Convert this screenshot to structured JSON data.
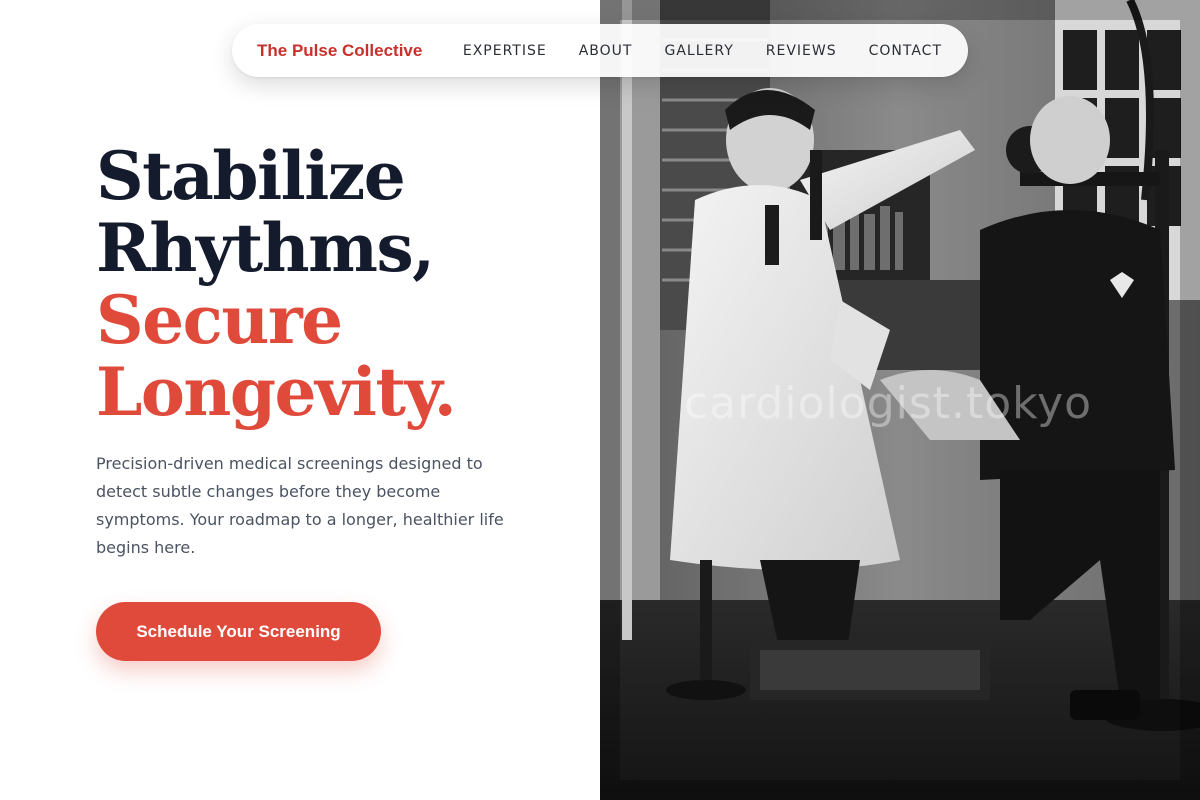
{
  "nav": {
    "brand": "The Pulse Collective",
    "links": [
      "EXPERTISE",
      "ABOUT",
      "GALLERY",
      "REVIEWS",
      "CONTACT"
    ]
  },
  "hero": {
    "headline_dark": [
      "Stabilize",
      "Rhythms,"
    ],
    "headline_accent": [
      "Secure",
      "Longevity."
    ],
    "lede": "Precision-driven medical screenings designed to detect subtle changes before they become symptoms. Your roadmap to a longer, healthier life begins here.",
    "cta_label": "Schedule Your Screening"
  },
  "photo": {
    "watermark": "cardiologist.tokyo",
    "style": "black-and-white vintage photograph"
  },
  "colors": {
    "brand": "#c8302b",
    "accent": "#e04a3b",
    "headline": "#141b2d",
    "body_text": "#4a5361"
  }
}
